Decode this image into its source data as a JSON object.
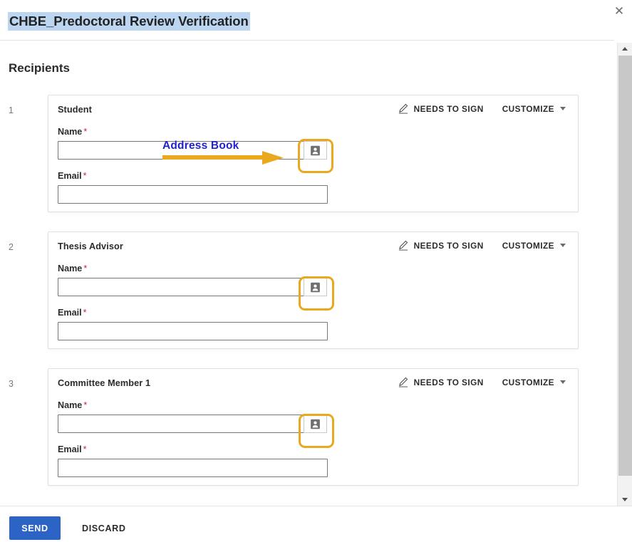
{
  "window": {
    "title": "CHBE_Predoctoral Review Verification",
    "title_selected": true,
    "close_icon": "close-icon",
    "selection_color": "#bcd6f2"
  },
  "main": {
    "section_title": "Recipients"
  },
  "labels": {
    "name": "Name",
    "email": "Email",
    "required_mark": "*",
    "needs_to_sign": "NEEDS TO SIGN",
    "customize": "CUSTOMIZE",
    "pencil_icon": "pencil-icon",
    "caret_icon": "chevron-down-icon",
    "address_book_icon": "address-book-icon"
  },
  "recipients": [
    {
      "index": "1",
      "role": "Student",
      "name_value": "",
      "email_value": "",
      "action": "NEEDS TO SIGN",
      "customize": "CUSTOMIZE"
    },
    {
      "index": "2",
      "role": "Thesis Advisor",
      "name_value": "",
      "email_value": "",
      "action": "NEEDS TO SIGN",
      "customize": "CUSTOMIZE"
    },
    {
      "index": "3",
      "role": "Committee Member 1",
      "name_value": "",
      "email_value": "",
      "action": "NEEDS TO SIGN",
      "customize": "CUSTOMIZE"
    }
  ],
  "annotation": {
    "text": "Address Book",
    "text_color": "#2222cc",
    "arrow_color": "#eaa81e",
    "highlight_color": "#eaa81e"
  },
  "footer": {
    "send_label": "SEND",
    "discard_label": "DISCARD",
    "send_color": "#2c64c6"
  },
  "scrollbar": {
    "up_icon": "scroll-up-arrow-icon",
    "down_icon": "scroll-down-arrow-icon"
  }
}
